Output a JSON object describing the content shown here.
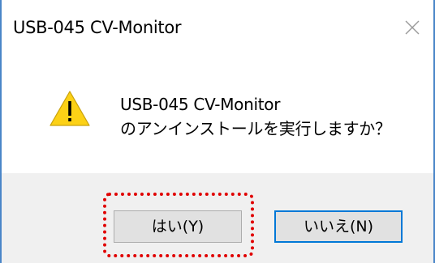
{
  "window": {
    "title": "USB-045 CV-Monitor",
    "close_icon": "close-icon"
  },
  "message": {
    "icon": "warning-icon",
    "line1": "USB-045 CV-Monitor",
    "line2": "のアンインストールを実行しますか？"
  },
  "buttons": {
    "yes_label": "はい(Y)",
    "no_label": "いいえ(N)"
  },
  "annotation": {
    "highlight_color": "#e00000",
    "highlighted": "yes-button"
  },
  "colors": {
    "frame": "#4a86c8",
    "footer": "#f0f0f0",
    "button": "#e1e1e1",
    "focus": "#0078d7",
    "warning": "#fcd116"
  }
}
